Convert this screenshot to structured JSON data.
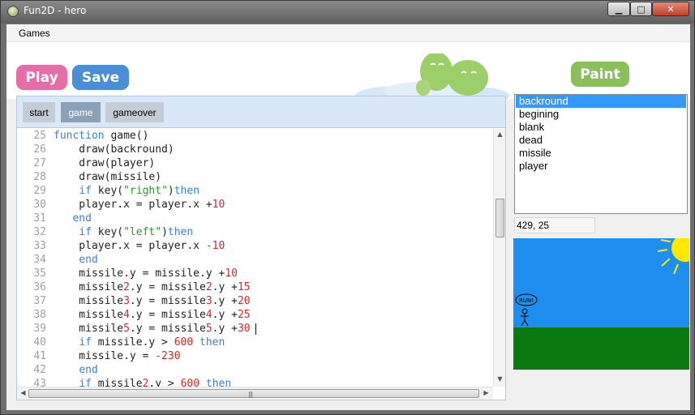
{
  "window": {
    "title": "Fun2D - hero"
  },
  "menu": {
    "games_label": "Games"
  },
  "toolbar": {
    "play_label": "Play",
    "save_label": "Save",
    "paint_label": "Paint"
  },
  "tabs": [
    "start",
    "game",
    "gameover"
  ],
  "active_tab": "game",
  "editor": {
    "line_numbers": [
      "25",
      "26",
      "27",
      "28",
      "29",
      "30",
      "31",
      "32",
      "33",
      "34",
      "35",
      "36",
      "37",
      "38",
      "39",
      "40",
      "41",
      "42",
      "43"
    ],
    "lines": [
      "function game()",
      "    draw(backround)",
      "    draw(player)",
      "    draw(missile)",
      "    if key(\"right\")then",
      "    player.x = player.x +10",
      "   end",
      "    if key(\"left\")then",
      "    player.x = player.x -10",
      "    end",
      "    missile.y = missile.y +10",
      "    missile2.y = missile2.y +15",
      "    missile3.y = missile3.y +20",
      "    missile4.y = missile4.y +25",
      "    missile5.y = missile5.y +30",
      "    if missile.y > 600 then",
      "    missile.y = -230",
      "    end",
      "    if missile2.y > 600 then"
    ]
  },
  "sprites": [
    "backround",
    "begining",
    "blank",
    "dead",
    "missile",
    "player"
  ],
  "selected_sprite": "backround",
  "coords": "429, 25",
  "preview": {
    "speech_bubble": "RUN!"
  },
  "colors": {
    "play": "#e66ea6",
    "save": "#4a8fd6",
    "paint": "#8bbf5a",
    "sky": "#1e8ff0",
    "grass": "#0a7a10",
    "sun": "#ffe800",
    "keyword": "#3a7fd0",
    "string": "#2a9a2a",
    "number": "#d22a2a"
  }
}
